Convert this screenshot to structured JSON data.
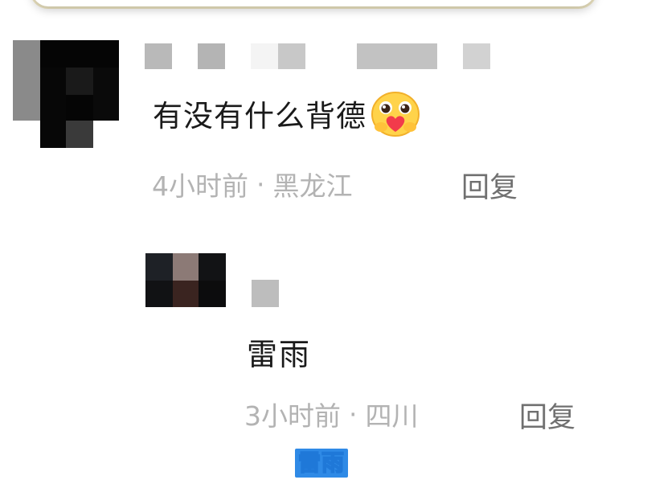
{
  "comments": [
    {
      "text": "有没有什么背德",
      "emoji": "hug-heart-emoji",
      "time": "4小时前",
      "separator": "·",
      "location": "黑龙江",
      "reply_label": "回复"
    },
    {
      "text": "雷雨",
      "time": "3小时前",
      "separator": "·",
      "location": "四川",
      "reply_label": "回复"
    }
  ],
  "caption": {
    "text": "雷雨"
  },
  "colors": {
    "text_primary": "#1a1a1a",
    "text_meta": "#b3b3b3",
    "reply_link": "#707070",
    "caption_fill": "#fff53a",
    "caption_stroke": "#1f78d8"
  }
}
